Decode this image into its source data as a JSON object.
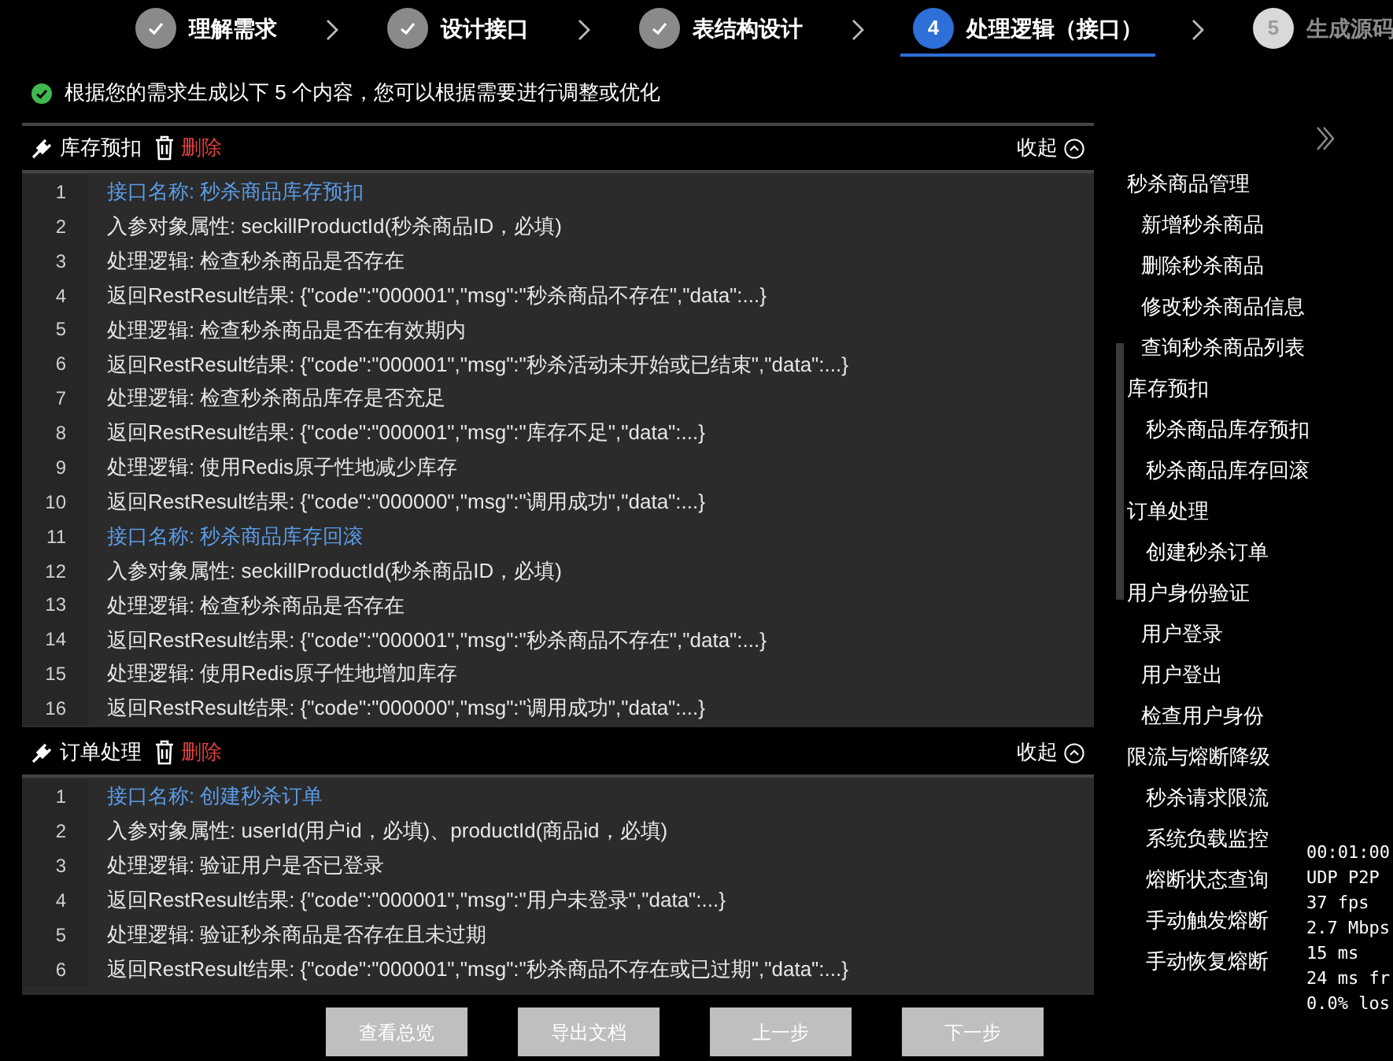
{
  "steps": [
    {
      "label": "理解需求",
      "done": true,
      "selected": false
    },
    {
      "label": "设计接口",
      "done": true,
      "selected": false
    },
    {
      "label": "表结构设计",
      "done": true,
      "selected": false
    },
    {
      "label": "处理逻辑（接口）",
      "done": false,
      "selected": true,
      "number": "4"
    },
    {
      "label": "生成源码",
      "done": false,
      "selected": false,
      "number": "5"
    }
  ],
  "notice": "根据您的需求生成以下 5 个内容，您可以根据需要进行调整或优化",
  "sections": [
    {
      "title": "库存预扣",
      "delete_label": "删除",
      "collapse_label": "收起",
      "lines": [
        {
          "no": "1",
          "text": "接口名称: 秒杀商品库存预扣",
          "kind": "heading"
        },
        {
          "no": "2",
          "text": "入参对象属性: seckillProductId(秒杀商品ID，必填)",
          "kind": "body"
        },
        {
          "no": "3",
          "text": "处理逻辑: 检查秒杀商品是否存在",
          "kind": "body"
        },
        {
          "no": "4",
          "text": "返回RestResult结果: {\"code\":\"000001\",\"msg\":\"秒杀商品不存在\",\"data\":...}",
          "kind": "body"
        },
        {
          "no": "5",
          "text": "处理逻辑: 检查秒杀商品是否在有效期内",
          "kind": "body"
        },
        {
          "no": "6",
          "text": "返回RestResult结果: {\"code\":\"000001\",\"msg\":\"秒杀活动未开始或已结束\",\"data\":...}",
          "kind": "body"
        },
        {
          "no": "7",
          "text": "处理逻辑: 检查秒杀商品库存是否充足",
          "kind": "body"
        },
        {
          "no": "8",
          "text": "返回RestResult结果: {\"code\":\"000001\",\"msg\":\"库存不足\",\"data\":...}",
          "kind": "body"
        },
        {
          "no": "9",
          "text": "处理逻辑: 使用Redis原子性地减少库存",
          "kind": "body"
        },
        {
          "no": "10",
          "text": "返回RestResult结果: {\"code\":\"000000\",\"msg\":\"调用成功\",\"data\":...}",
          "kind": "body"
        },
        {
          "no": "11",
          "text": "接口名称: 秒杀商品库存回滚",
          "kind": "heading"
        },
        {
          "no": "12",
          "text": "入参对象属性: seckillProductId(秒杀商品ID，必填)",
          "kind": "body"
        },
        {
          "no": "13",
          "text": "处理逻辑: 检查秒杀商品是否存在",
          "kind": "body"
        },
        {
          "no": "14",
          "text": "返回RestResult结果: {\"code\":\"000001\",\"msg\":\"秒杀商品不存在\",\"data\":...}",
          "kind": "body"
        },
        {
          "no": "15",
          "text": "处理逻辑: 使用Redis原子性地增加库存",
          "kind": "body"
        },
        {
          "no": "16",
          "text": "返回RestResult结果: {\"code\":\"000000\",\"msg\":\"调用成功\",\"data\":...}",
          "kind": "body"
        }
      ]
    },
    {
      "title": "订单处理",
      "delete_label": "删除",
      "collapse_label": "收起",
      "lines": [
        {
          "no": "1",
          "text": "接口名称: 创建秒杀订单",
          "kind": "heading"
        },
        {
          "no": "2",
          "text": "入参对象属性: userId(用户id，必填)、productId(商品id，必填)",
          "kind": "body"
        },
        {
          "no": "3",
          "text": "处理逻辑: 验证用户是否已登录",
          "kind": "body"
        },
        {
          "no": "4",
          "text": "返回RestResult结果: {\"code\":\"000001\",\"msg\":\"用户未登录\",\"data\":...}",
          "kind": "body"
        },
        {
          "no": "5",
          "text": "处理逻辑: 验证秒杀商品是否存在且未过期",
          "kind": "body"
        },
        {
          "no": "6",
          "text": "返回RestResult结果: {\"code\":\"000001\",\"msg\":\"秒杀商品不存在或已过期\",\"data\":...}",
          "kind": "body"
        }
      ]
    }
  ],
  "buttons": [
    "查看总览",
    "导出文档",
    "上一步",
    "下一步"
  ],
  "outline": [
    {
      "label": "秒杀商品管理",
      "children": [
        {
          "label": "新增秒杀商品"
        },
        {
          "label": "删除秒杀商品"
        },
        {
          "label": "修改秒杀商品信息"
        },
        {
          "label": "查询秒杀商品列表"
        }
      ]
    },
    {
      "label": "库存预扣",
      "children": [
        {
          "label": "秒杀商品库存预扣"
        },
        {
          "label": "秒杀商品库存回滚"
        }
      ]
    },
    {
      "label": "订单处理",
      "children": [
        {
          "label": "创建秒杀订单"
        }
      ]
    },
    {
      "label": "用户身份验证",
      "children": [
        {
          "label": "用户登录"
        },
        {
          "label": "用户登出"
        },
        {
          "label": "检查用户身份"
        }
      ]
    },
    {
      "label": "限流与熔断降级",
      "children": [
        {
          "label": "秒杀请求限流"
        },
        {
          "label": "系统负载监控"
        },
        {
          "label": "熔断状态查询"
        },
        {
          "label": "手动触发熔断"
        },
        {
          "label": "手动恢复熔断"
        }
      ]
    }
  ],
  "stats": [
    "00:01:00",
    "UDP P2P",
    "37 fps",
    "2.7 Mbps",
    "15 ms",
    "24 ms fr",
    "0.0% los"
  ]
}
